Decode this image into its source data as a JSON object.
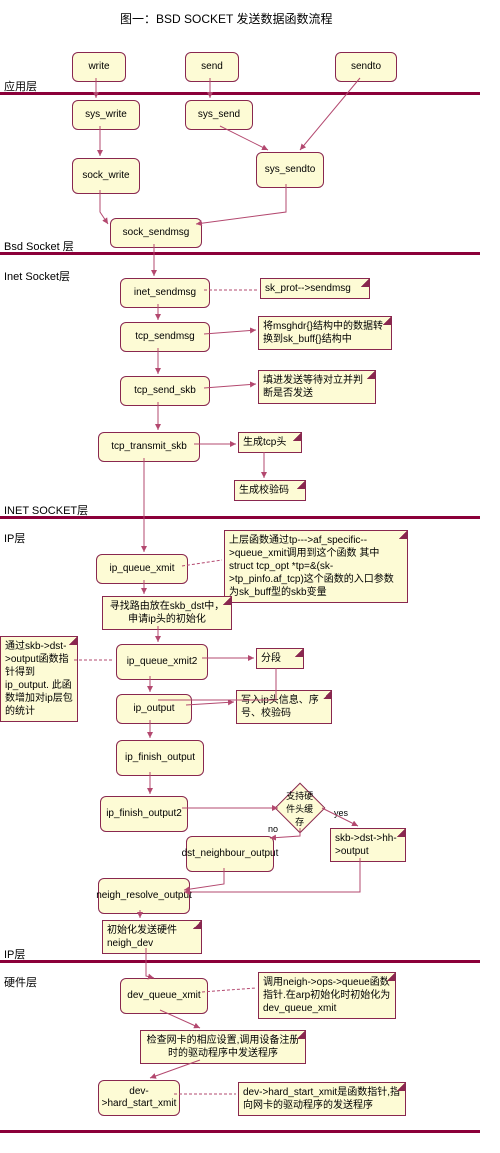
{
  "title": "图一：BSD SOCKET 发送数据函数流程",
  "layers": {
    "app": "应用层",
    "bsd": "Bsd Socket 层",
    "inet": "Inet Socket层",
    "inet2": "INET SOCKET层",
    "ip": "IP层",
    "ip2": "IP层",
    "hw": "硬件层"
  },
  "boxes": {
    "write": "write",
    "send": "send",
    "sendto": "sendto",
    "sys_write": "sys_write",
    "sys_send": "sys_send",
    "sys_sendto": "sys_sendto",
    "sock_write": "sock_write",
    "sock_sendmsg": "sock_sendmsg",
    "inet_sendmsg": "inet_sendmsg",
    "tcp_sendmsg": "tcp_sendmsg",
    "tcp_send_skb": "tcp_send_skb",
    "tcp_transmit_skb": "tcp_transmit_skb",
    "ip_queue_xmit": "ip_queue_xmit",
    "ip_queue_xmit2": "ip_queue_xmit2",
    "ip_output": "ip_output",
    "ip_finish_output": "ip_finish_output",
    "ip_finish_output2": "ip_finish_output2",
    "dst_neighbour_output": "dst_neighbour_output",
    "neigh_resolve_output": "neigh_resolve_output",
    "dev_queue_xmit": "dev_queue_xmit",
    "hard_start_xmit": "dev->hard_start_xmit"
  },
  "notes": {
    "sk_prot": "sk_prot-->sendmsg",
    "msghdr": "将msghdr{}结构中的数据转换到sk_buff{}结构中",
    "wait": "填进发送等待对立并判断是否发送",
    "gen_tcp": "生成tcp头",
    "gen_chk": "生成校验码",
    "af_specific": "上层函数通过tp--->af_specific-->queue_xmit调用到这个函数 其中struct tcp_opt *tp=&(sk->tp_pinfo.af_tcp)这个函数的入口参数为sk_buff型的skb变量",
    "route": "寻找路由放在skb_dst中，申请ip头的初始化",
    "frag": "分段",
    "skb_output": "通过skb->dst->output函数指针得到ip_output. 此函数增加对ip层包的统计",
    "ip_info": "写入ip头信息、序号、校验码",
    "hw_cache": "支持硬件头缓存",
    "skb_hh": "skb->dst->hh->output",
    "init_neigh": "初始化发送硬件neigh_dev",
    "neigh_ops": "调用neigh->ops->queue函数指针.在arp初始化时初始化为dev_queue_xmit",
    "nic": "检查网卡的相应设置,调用设备注册时的驱动程序中发送程序",
    "hard_ptr": "dev->hard_start_xmit是函数指针,指向网卡的驱动程序的发送程序"
  },
  "branch": {
    "yes": "yes",
    "no": "no"
  }
}
